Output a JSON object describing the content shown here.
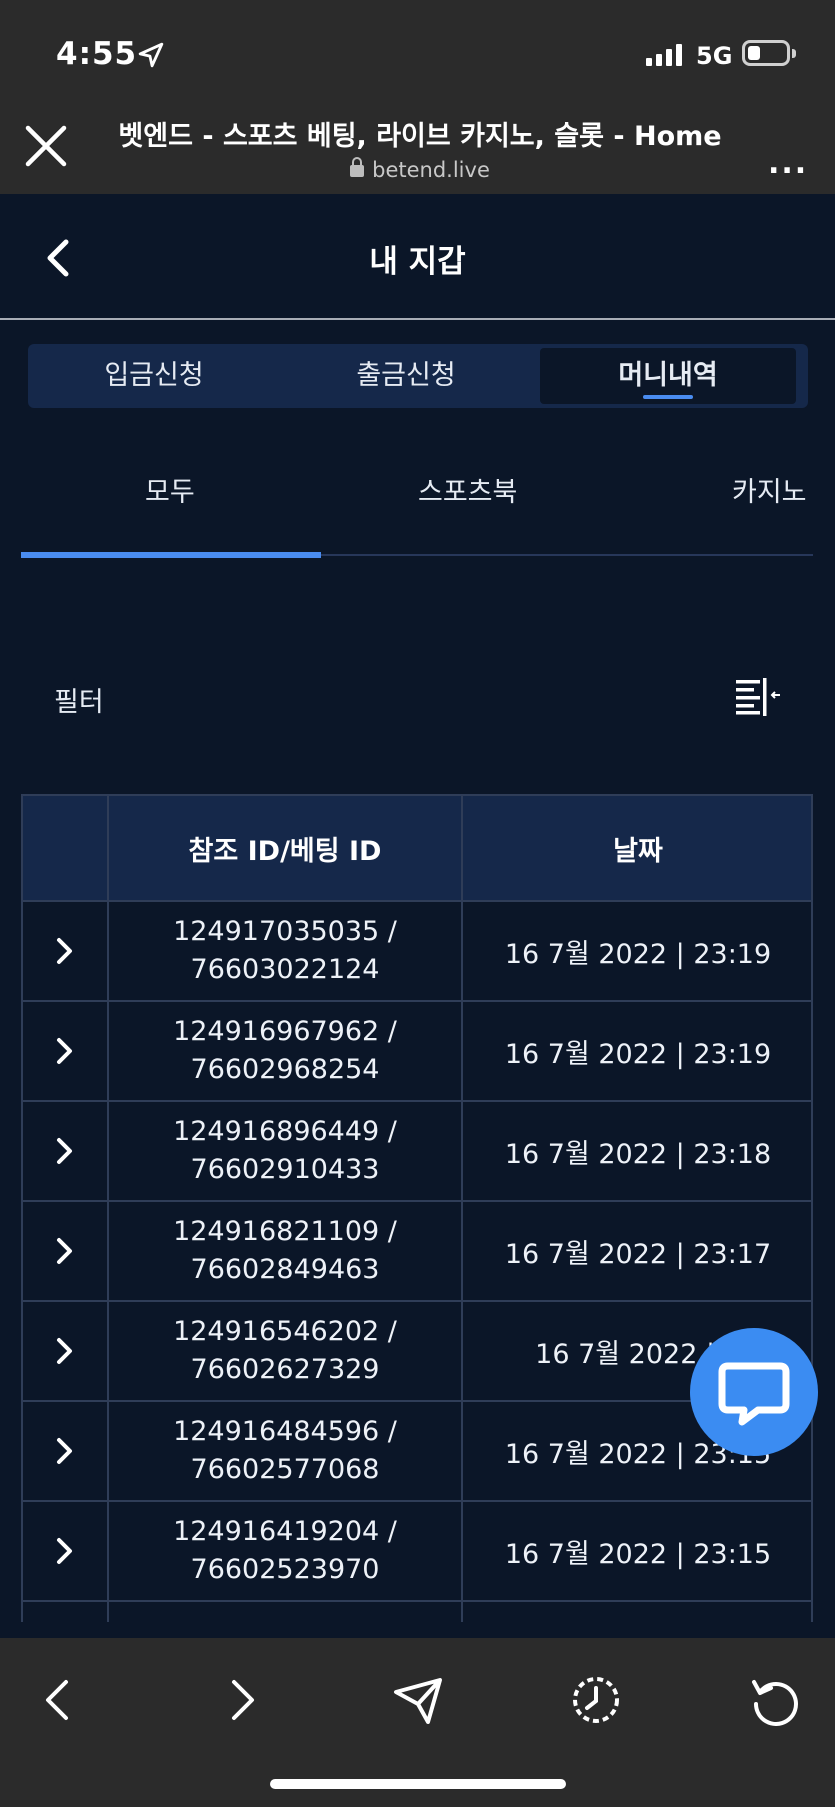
{
  "status_bar": {
    "time": "4:55",
    "network": "5G",
    "icons": [
      "location-arrow-icon",
      "signal-bars-icon",
      "battery-icon"
    ]
  },
  "browser": {
    "title": "벳엔드 - 스포츠 베팅, 라이브 카지노, 슬롯 - Home",
    "url": "betend.live",
    "more_label": "...",
    "icons": [
      "close-icon",
      "lock-icon"
    ]
  },
  "header": {
    "title": "내 지갑",
    "back_icon": "chevron-left-icon"
  },
  "tabs": [
    {
      "label": "입금신청",
      "active": false
    },
    {
      "label": "출금신청",
      "active": false
    },
    {
      "label": "머니내역",
      "active": true
    }
  ],
  "subtabs": [
    {
      "label": "모두",
      "active": true
    },
    {
      "label": "스포츠북",
      "active": false
    },
    {
      "label": "카지노",
      "active": false
    }
  ],
  "filter": {
    "label": "필터",
    "icon": "filter-collapse-icon"
  },
  "table": {
    "headers": [
      "",
      "참조 ID/베팅 ID",
      "날짜"
    ],
    "rows": [
      {
        "ref": "124917035035 /",
        "bet": "76603022124",
        "date": "16 7월 2022 | 23:19"
      },
      {
        "ref": "124916967962 /",
        "bet": "76602968254",
        "date": "16 7월 2022 | 23:19"
      },
      {
        "ref": "124916896449 /",
        "bet": "76602910433",
        "date": "16 7월 2022 | 23:18"
      },
      {
        "ref": "124916821109 /",
        "bet": "76602849463",
        "date": "16 7월 2022 | 23:17"
      },
      {
        "ref": "124916546202 /",
        "bet": "76602627329",
        "date": "16 7월 2022 | 2"
      },
      {
        "ref": "124916484596 /",
        "bet": "76602577068",
        "date": "16 7월 2022 | 23:15"
      },
      {
        "ref": "124916419204 /",
        "bet": "76602523970",
        "date": "16 7월 2022 | 23:15"
      }
    ]
  },
  "chat": {
    "icon": "chat-bubble-icon",
    "color": "#3b8cf2"
  },
  "bottom_bar": {
    "icons": [
      "back-arrow-icon",
      "forward-arrow-icon",
      "share-send-icon",
      "history-icon",
      "reload-icon"
    ]
  },
  "colors": {
    "background": "#0b1628",
    "accent": "#4a8cf0",
    "panel": "#15284a",
    "system_bar": "#2b2b2b"
  }
}
